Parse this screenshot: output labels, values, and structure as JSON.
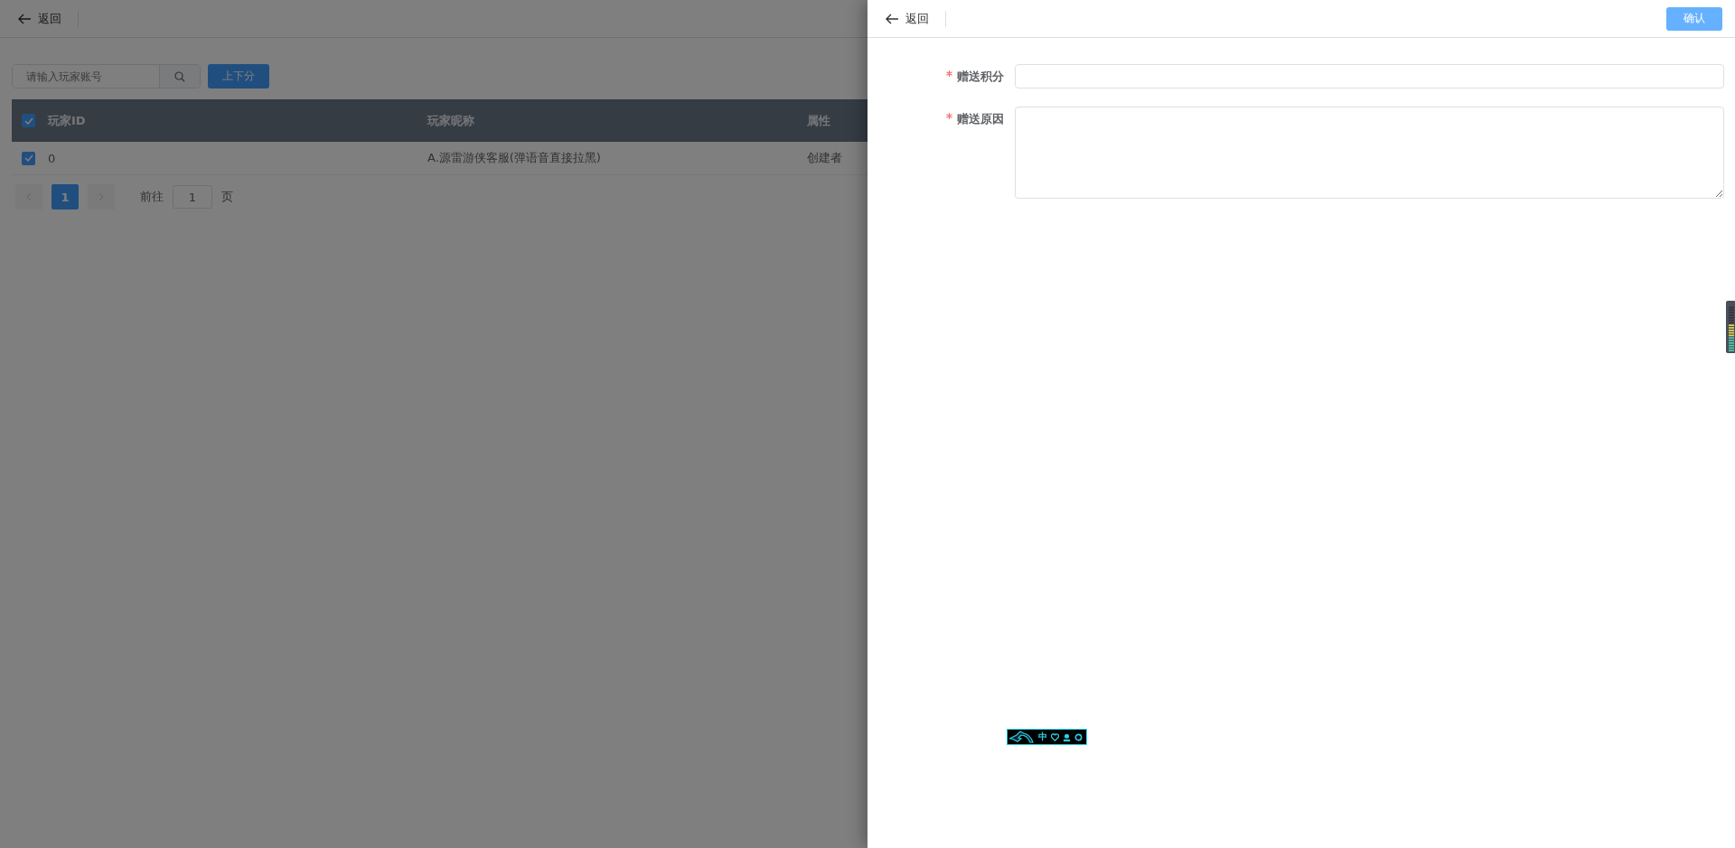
{
  "page": {
    "back": "返回",
    "search": {
      "placeholder": "请输入玩家账号"
    },
    "action_button": "上下分",
    "table": {
      "select_all_checked": true,
      "columns": [
        "玩家ID",
        "玩家昵称",
        "属性"
      ],
      "rows": [
        {
          "checked": true,
          "cells": [
            "0",
            "A.源雷游侠客服(弹语音直接拉黑)",
            "创建者"
          ]
        }
      ]
    },
    "pagination": {
      "pages": [
        {
          "label": "1",
          "selected": true
        }
      ],
      "goto_label": "前往",
      "goto_value": "1",
      "page_suffix": "页"
    }
  },
  "drawer": {
    "back": "返回",
    "confirm": "确认",
    "fields": [
      {
        "kind": "input",
        "label": "赠送积分",
        "required": true
      },
      {
        "kind": "textarea",
        "label": "赠送原因",
        "required": true
      }
    ]
  },
  "ime_toolbar": {
    "mode": "中"
  }
}
